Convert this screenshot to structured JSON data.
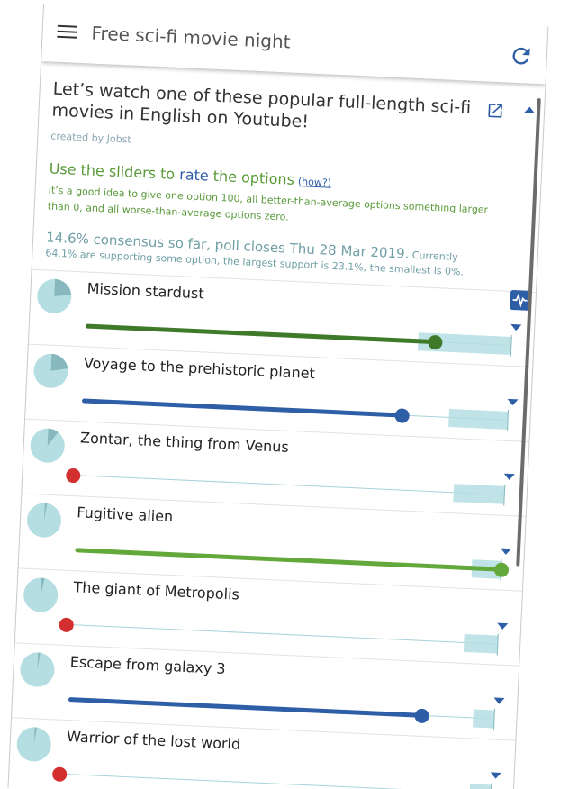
{
  "app_bar": {
    "title": "Free sci-fi movie night",
    "menu_icon": "hamburger-menu-icon",
    "refresh_icon": "refresh-icon"
  },
  "poll": {
    "title": "Let’s watch one of these popular full-length sci-fi movies in English on Youtube!",
    "created_by": "created by Jobst",
    "instruction": {
      "prefix": "Use the sliders to ",
      "rate": "rate",
      "suffix": " the options",
      "how": "(how?)"
    },
    "hint": "It’s a good idea to give one option 100, all better-than-average options something larger than 0, and all worse-than-average options zero.",
    "status": {
      "main": "14.6% consensus so far, poll closes Thu 28 Mar 2019.",
      "small": " Currently",
      "line2": "64.1% are supporting some option, the largest support is 23.1%, the smallest is 0%."
    }
  },
  "colors": {
    "accent": "#2e5ea6",
    "green": "#5a9a3a",
    "dark_green": "#3f7a2a",
    "red": "#d32f2f",
    "teal": "#b4dee2"
  },
  "options": [
    {
      "name": "Mission stardust",
      "rating": 82,
      "color": "#3f7a2a",
      "support_fraction": 0.23,
      "band_start": 0.78
    },
    {
      "name": "Voyage to the prehistoric planet",
      "rating": 75,
      "color": "#2e5ea6",
      "support_fraction": 0.22,
      "band_start": 0.86
    },
    {
      "name": "Zontar, the thing from Venus",
      "rating": 0,
      "color": "#d32f2f",
      "support_fraction": 0.1,
      "band_start": 0.88
    },
    {
      "name": "Fugitive alien",
      "rating": 100,
      "color": "#62a83a",
      "support_fraction": 0.02,
      "band_start": 0.93
    },
    {
      "name": "The giant of Metropolis",
      "rating": 0,
      "color": "#d32f2f",
      "support_fraction": 0.03,
      "band_start": 0.92
    },
    {
      "name": "Escape from galaxy 3",
      "rating": 83,
      "color": "#2e5ea6",
      "support_fraction": 0.02,
      "band_start": 0.95
    },
    {
      "name": "Warrior of the lost world",
      "rating": 0,
      "color": "#d32f2f",
      "support_fraction": 0.02,
      "band_start": 0.95
    }
  ]
}
